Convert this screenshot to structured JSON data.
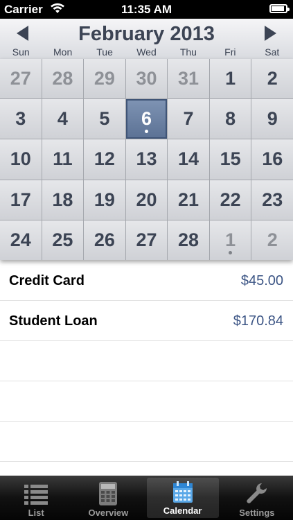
{
  "status_bar": {
    "carrier": "Carrier",
    "time": "11:35 AM",
    "battery_level": 0.9
  },
  "calendar": {
    "month_title": "February 2013",
    "weekdays": [
      "Sun",
      "Mon",
      "Tue",
      "Wed",
      "Thu",
      "Fri",
      "Sat"
    ],
    "days": [
      {
        "n": "27",
        "other": true
      },
      {
        "n": "28",
        "other": true
      },
      {
        "n": "29",
        "other": true
      },
      {
        "n": "30",
        "other": true
      },
      {
        "n": "31",
        "other": true
      },
      {
        "n": "1"
      },
      {
        "n": "2"
      },
      {
        "n": "3"
      },
      {
        "n": "4"
      },
      {
        "n": "5"
      },
      {
        "n": "6",
        "selected": true,
        "dot": true
      },
      {
        "n": "7"
      },
      {
        "n": "8"
      },
      {
        "n": "9"
      },
      {
        "n": "10"
      },
      {
        "n": "11"
      },
      {
        "n": "12"
      },
      {
        "n": "13"
      },
      {
        "n": "14"
      },
      {
        "n": "15"
      },
      {
        "n": "16"
      },
      {
        "n": "17"
      },
      {
        "n": "18"
      },
      {
        "n": "19"
      },
      {
        "n": "20"
      },
      {
        "n": "21"
      },
      {
        "n": "22"
      },
      {
        "n": "23"
      },
      {
        "n": "24"
      },
      {
        "n": "25"
      },
      {
        "n": "26"
      },
      {
        "n": "27"
      },
      {
        "n": "28"
      },
      {
        "n": "1",
        "other": true,
        "dot": true
      },
      {
        "n": "2",
        "other": true
      }
    ]
  },
  "list": {
    "rows": [
      {
        "name": "Credit Card",
        "amount": "$45.00"
      },
      {
        "name": "Student Loan",
        "amount": "$170.84"
      },
      {
        "name": "",
        "amount": ""
      },
      {
        "name": "",
        "amount": ""
      },
      {
        "name": "",
        "amount": ""
      }
    ]
  },
  "tabs": [
    {
      "label": "List",
      "icon": "list-icon",
      "active": false
    },
    {
      "label": "Overview",
      "icon": "calculator-icon",
      "active": false
    },
    {
      "label": "Calendar",
      "icon": "calendar-icon",
      "active": true
    },
    {
      "label": "Settings",
      "icon": "wrench-icon",
      "active": false
    }
  ],
  "colors": {
    "accent": "#3c5585",
    "header_text": "#3c4454",
    "selected_day": "#6a80a4"
  }
}
